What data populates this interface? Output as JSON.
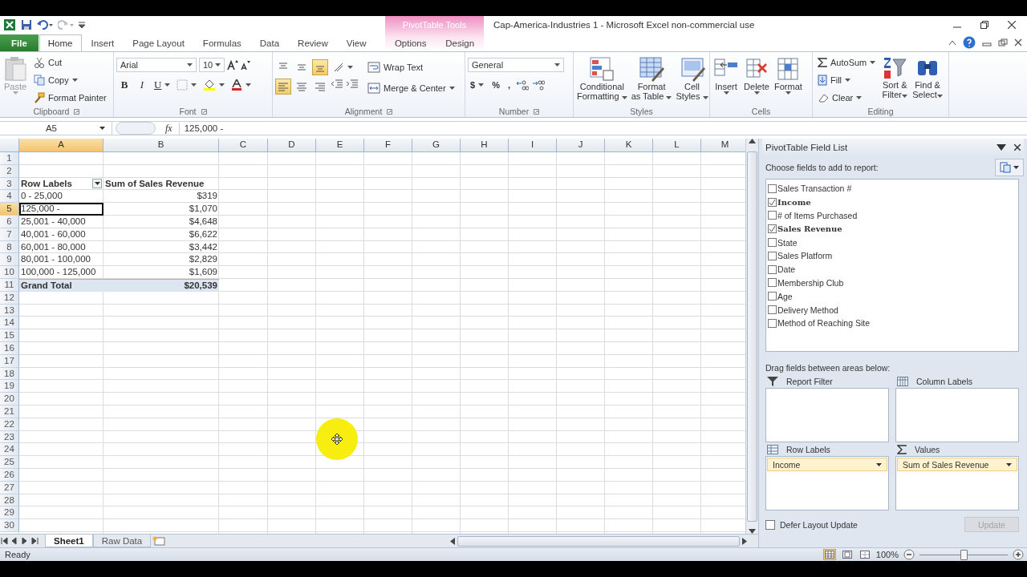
{
  "window": {
    "title": "Cap-America-Industries 1  -  Microsoft Excel non-commercial use",
    "context_title": "PivotTable Tools"
  },
  "tabs": [
    {
      "label": "File",
      "kind": "file",
      "selected": false
    },
    {
      "label": "Home",
      "kind": "tab",
      "selected": true
    },
    {
      "label": "Insert",
      "kind": "tab",
      "selected": false
    },
    {
      "label": "Page Layout",
      "kind": "tab",
      "selected": false
    },
    {
      "label": "Formulas",
      "kind": "tab",
      "selected": false
    },
    {
      "label": "Data",
      "kind": "tab",
      "selected": false
    },
    {
      "label": "Review",
      "kind": "tab",
      "selected": false
    },
    {
      "label": "View",
      "kind": "tab",
      "selected": false
    }
  ],
  "context_tabs": [
    {
      "label": "Options",
      "selected": false
    },
    {
      "label": "Design",
      "selected": false
    }
  ],
  "ribbon": {
    "clipboard": {
      "title": "Clipboard",
      "paste": "Paste",
      "cut": "Cut",
      "copy": "Copy",
      "format_painter": "Format Painter"
    },
    "font": {
      "title": "Font",
      "family": "Arial",
      "size": "10",
      "bold": "B",
      "italic": "I",
      "underline": "U"
    },
    "alignment": {
      "title": "Alignment",
      "wrap": "Wrap Text",
      "merge": "Merge & Center",
      "vertical": [
        {
          "selected": false
        },
        {
          "selected": false
        },
        {
          "selected": true
        }
      ],
      "horizontal": [
        {
          "selected": true
        },
        {
          "selected": false
        },
        {
          "selected": false
        }
      ]
    },
    "number": {
      "title": "Number",
      "format": "General",
      "currency": "$",
      "percent": "%",
      "comma": ","
    },
    "styles": {
      "title": "Styles",
      "buttons": [
        {
          "lines": [
            "Conditional",
            "Formatting"
          ],
          "kind": "conditional"
        },
        {
          "lines": [
            "Format",
            "as Table"
          ],
          "kind": "table"
        },
        {
          "lines": [
            "Cell",
            "Styles"
          ],
          "kind": "cellstyles"
        }
      ]
    },
    "cells": {
      "title": "Cells",
      "buttons": [
        {
          "label": "Insert",
          "kind": "insert"
        },
        {
          "label": "Delete",
          "kind": "delete"
        },
        {
          "label": "Format",
          "kind": "format"
        }
      ]
    },
    "editing": {
      "title": "Editing",
      "autosum": "AutoSum",
      "fill": "Fill",
      "clear": "Clear",
      "sort": [
        "Sort &",
        "Filter"
      ],
      "find": [
        "Find &",
        "Select"
      ]
    }
  },
  "sheet": {
    "name_box": "A5",
    "fx": "fx",
    "formula": "125,000 -",
    "columns": [
      {
        "label": "A",
        "selected": true
      },
      {
        "label": "B",
        "selected": false
      },
      {
        "label": "C",
        "selected": false
      },
      {
        "label": "D",
        "selected": false
      },
      {
        "label": "E",
        "selected": false
      },
      {
        "label": "F",
        "selected": false
      },
      {
        "label": "G",
        "selected": false
      },
      {
        "label": "H",
        "selected": false
      },
      {
        "label": "I",
        "selected": false
      },
      {
        "label": "J",
        "selected": false
      },
      {
        "label": "K",
        "selected": false
      },
      {
        "label": "L",
        "selected": false
      },
      {
        "label": "M",
        "selected": false
      }
    ],
    "rows": [
      {
        "label": "1",
        "selected": false
      },
      {
        "label": "2",
        "selected": false
      },
      {
        "label": "3",
        "selected": false
      },
      {
        "label": "4",
        "selected": false
      },
      {
        "label": "5",
        "selected": true
      },
      {
        "label": "6",
        "selected": false
      },
      {
        "label": "7",
        "selected": false
      },
      {
        "label": "8",
        "selected": false
      },
      {
        "label": "9",
        "selected": false
      },
      {
        "label": "10",
        "selected": false
      },
      {
        "label": "11",
        "selected": false
      },
      {
        "label": "12",
        "selected": false
      },
      {
        "label": "13",
        "selected": false
      },
      {
        "label": "14",
        "selected": false
      },
      {
        "label": "15",
        "selected": false
      },
      {
        "label": "16",
        "selected": false
      },
      {
        "label": "17",
        "selected": false
      },
      {
        "label": "18",
        "selected": false
      },
      {
        "label": "19",
        "selected": false
      },
      {
        "label": "20",
        "selected": false
      },
      {
        "label": "21",
        "selected": false
      },
      {
        "label": "22",
        "selected": false
      },
      {
        "label": "23",
        "selected": false
      },
      {
        "label": "24",
        "selected": false
      },
      {
        "label": "25",
        "selected": false
      },
      {
        "label": "26",
        "selected": false
      },
      {
        "label": "27",
        "selected": false
      },
      {
        "label": "28",
        "selected": false
      },
      {
        "label": "29",
        "selected": false
      },
      {
        "label": "30",
        "selected": false
      }
    ],
    "pivot": {
      "header": [
        "Row Labels",
        "Sum of Sales Revenue"
      ],
      "items": [
        {
          "label": "0 - 25,000",
          "value": "$319",
          "selected": false
        },
        {
          "label": "125,000 -",
          "value": "$1,070",
          "selected": true
        },
        {
          "label": "25,001 - 40,000",
          "value": "$4,648",
          "selected": false
        },
        {
          "label": "40,001 - 60,000",
          "value": "$6,622",
          "selected": false
        },
        {
          "label": "60,001 - 80,000",
          "value": "$3,442",
          "selected": false
        },
        {
          "label": "80,001 - 100,000",
          "value": "$2,829",
          "selected": false
        },
        {
          "label": "100,000 - 125,000",
          "value": "$1,609",
          "selected": false
        }
      ],
      "total": {
        "label": "Grand Total",
        "value": "$20,539"
      }
    },
    "sheet_tabs": [
      {
        "label": "Sheet1",
        "selected": true
      },
      {
        "label": "Raw Data",
        "selected": false
      }
    ]
  },
  "field_list": {
    "title": "PivotTable Field List",
    "prompt": "Choose fields to add to report:",
    "fields": [
      {
        "label": "Sales Transaction #",
        "checked": false
      },
      {
        "label": "Income",
        "checked": true
      },
      {
        "label": "# of Items Purchased",
        "checked": false
      },
      {
        "label": "Sales Revenue",
        "checked": true
      },
      {
        "label": "State",
        "checked": false
      },
      {
        "label": "Sales Platform",
        "checked": false
      },
      {
        "label": "Date",
        "checked": false
      },
      {
        "label": "Membership Club",
        "checked": false
      },
      {
        "label": "Age",
        "checked": false
      },
      {
        "label": "Delivery Method",
        "checked": false
      },
      {
        "label": "Method of Reaching Site",
        "checked": false
      }
    ],
    "areas_prompt": "Drag fields between areas below:",
    "areas": [
      {
        "label": "Report Filter",
        "kind": "filter"
      },
      {
        "label": "Column Labels",
        "kind": "columns"
      },
      {
        "label": "Row Labels",
        "kind": "rows",
        "items": [
          "Income"
        ]
      },
      {
        "label": "Values",
        "kind": "values",
        "items": [
          "Sum of Sales Revenue"
        ]
      }
    ],
    "defer": {
      "label": "Defer Layout Update",
      "checked": false
    },
    "update": {
      "label": "Update",
      "disabled": true
    }
  },
  "status_bar": {
    "text": "Ready",
    "views": [
      {
        "selected": true
      },
      {
        "selected": false
      },
      {
        "selected": false
      }
    ],
    "zoom": "100%",
    "zoom_slider": {
      "level": 0.5
    }
  }
}
